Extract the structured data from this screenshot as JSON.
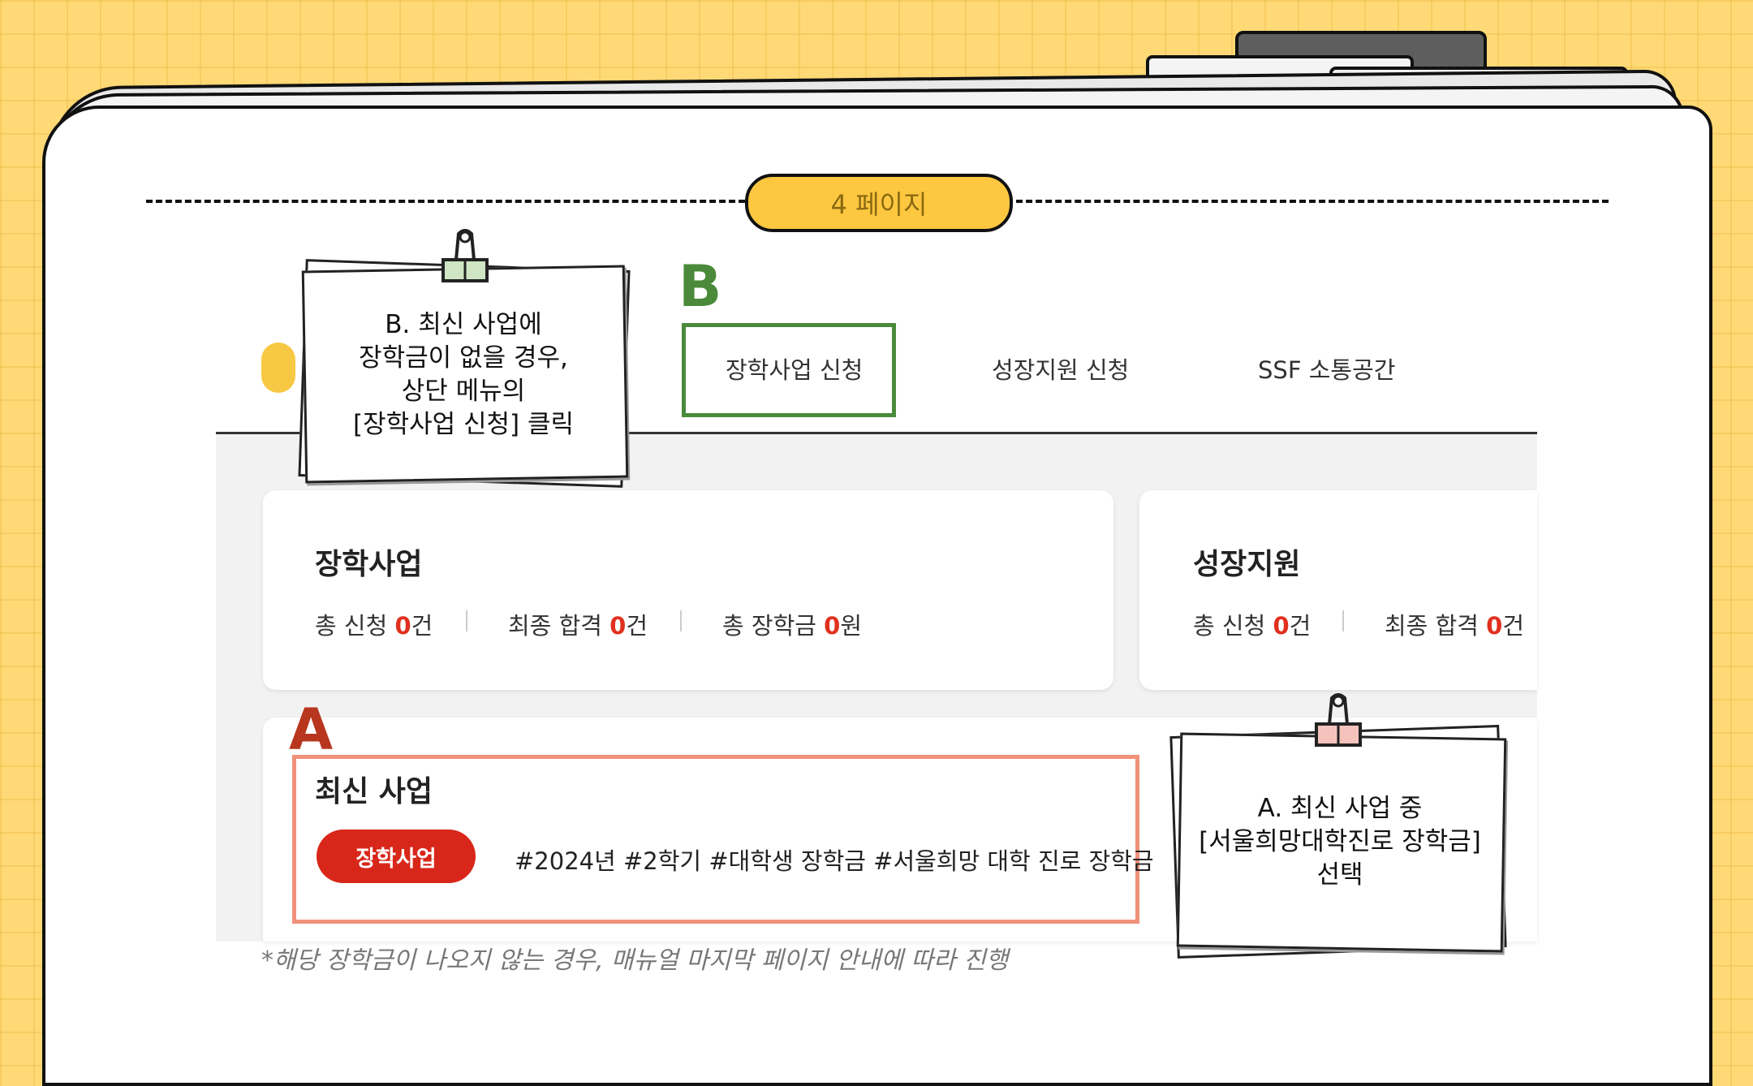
{
  "page_indicator": "4 페이지",
  "nav": {
    "items": [
      "장학사업 신청",
      "성장지원 신청",
      "SSF 소통공간"
    ]
  },
  "markers": {
    "a": "A",
    "b": "B"
  },
  "cards": {
    "scholarship": {
      "title": "장학사업",
      "stats": [
        {
          "label": "총 신청 ",
          "num": "0",
          "unit": "건"
        },
        {
          "label": "최종 합격 ",
          "num": "0",
          "unit": "건"
        },
        {
          "label": "총 장학금 ",
          "num": "0",
          "unit": "원"
        }
      ]
    },
    "growth": {
      "title": "성장지원",
      "stats": [
        {
          "label": "총 신청 ",
          "num": "0",
          "unit": "건"
        },
        {
          "label": "최종 합격 ",
          "num": "0",
          "unit": "건"
        }
      ]
    }
  },
  "latest": {
    "title": "최신 사업",
    "category": "장학사업",
    "tags": "#2024년 #2학기 #대학생 장학금 #서울희망 대학 진로 장학금"
  },
  "sticky_b": {
    "lines": [
      "B. 최신 사업에",
      "장학금이 없을 경우,",
      "상단 메뉴의",
      "[장학사업 신청] 클릭"
    ]
  },
  "sticky_a": {
    "lines": [
      "A. 최신 사업 중",
      "[서울희망대학진로 장학금]",
      "선택"
    ]
  },
  "footnote": "*해당 장학금이 나오지 않는 경우, 매뉴얼 마지막 페이지 안내에 따라 진행",
  "colors": {
    "background": "#ffd976",
    "accent_yellow": "#fdc740",
    "marker_b": "#4a8a3a",
    "marker_a": "#b8361e",
    "number_red": "#e0301e",
    "category_red": "#d8271a"
  }
}
